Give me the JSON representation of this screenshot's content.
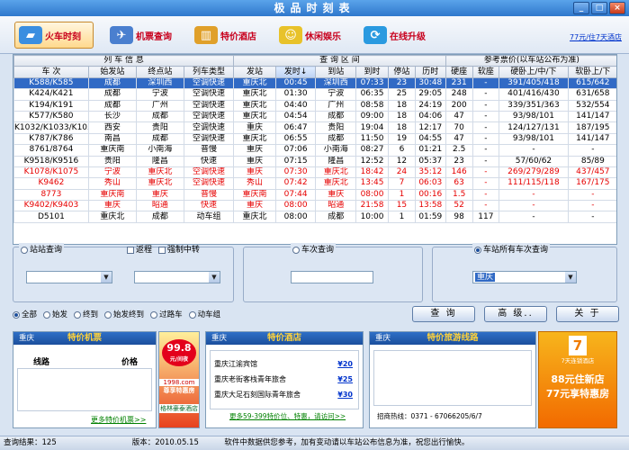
{
  "app": {
    "title": "极品时刻表",
    "ad_link": "77元/住7天酒店"
  },
  "toolbar": [
    {
      "label": "火车时刻",
      "icon": "train-icon",
      "color": "#3a8ee0"
    },
    {
      "label": "机票查询",
      "icon": "airplane-icon",
      "color": "#4a7fcf"
    },
    {
      "label": "特价酒店",
      "icon": "hotel-icon",
      "color": "#e0a02a"
    },
    {
      "label": "休闲娱乐",
      "icon": "smiley-icon",
      "color": "#e8c22a"
    },
    {
      "label": "在线升级",
      "icon": "upgrade-icon",
      "color": "#2a9ae0"
    }
  ],
  "grid": {
    "group_headers": {
      "train": "列 车 信 息",
      "query": "查 询 区 间",
      "price": "参考票价(以车站公布为准)"
    },
    "columns": [
      "车 次",
      "始发站",
      "终点站",
      "列车类型",
      "发站",
      "发时↓",
      "到站",
      "到时",
      "停站",
      "历时",
      "硬座",
      "软座",
      "硬卧上/中/下",
      "软卧上/下"
    ],
    "rows": [
      [
        "K588/K585",
        "成都",
        "深圳西",
        "空调快速",
        "重庆北",
        "00:45",
        "深圳西",
        "07:33",
        "23",
        "30:48",
        "231",
        "-",
        "391/405/418",
        "615/642"
      ],
      [
        "K424/K421",
        "成都",
        "宁波",
        "空调快速",
        "重庆北",
        "01:30",
        "宁波",
        "06:35",
        "25",
        "29:05",
        "248",
        "-",
        "401/416/430",
        "631/658"
      ],
      [
        "K194/K191",
        "成都",
        "广州",
        "空调快速",
        "重庆北",
        "04:40",
        "广州",
        "08:58",
        "18",
        "24:19",
        "200",
        "-",
        "339/351/363",
        "532/554"
      ],
      [
        "K577/K580",
        "长沙",
        "成都",
        "空调快速",
        "重庆北",
        "04:54",
        "成都",
        "09:00",
        "18",
        "04:06",
        "47",
        "-",
        "93/98/101",
        "141/147"
      ],
      [
        "K1032/K1033/K103",
        "西安",
        "贵阳",
        "空调快速",
        "重庆",
        "06:47",
        "贵阳",
        "19:04",
        "18",
        "12:17",
        "70",
        "-",
        "124/127/131",
        "187/195"
      ],
      [
        "K787/K786",
        "南昌",
        "成都",
        "空调快速",
        "重庆北",
        "06:55",
        "成都",
        "11:50",
        "19",
        "04:55",
        "47",
        "-",
        "93/98/101",
        "141/147"
      ],
      [
        "8761/8764",
        "重庆南",
        "小南海",
        "普慢",
        "重庆",
        "07:06",
        "小南海",
        "08:27",
        "6",
        "01:21",
        "2.5",
        "-",
        "-",
        "-"
      ],
      [
        "K9518/K9516",
        "贵阳",
        "隆昌",
        "快速",
        "重庆",
        "07:15",
        "隆昌",
        "12:52",
        "12",
        "05:37",
        "23",
        "-",
        "57/60/62",
        "85/89"
      ],
      [
        "K1078/K1075",
        "宁波",
        "重庆北",
        "空调快速",
        "重庆",
        "07:30",
        "重庆北",
        "18:42",
        "24",
        "35:12",
        "146",
        "-",
        "269/279/289",
        "437/457"
      ],
      [
        "K9462",
        "秀山",
        "重庆北",
        "空调快速",
        "秀山",
        "07:42",
        "重庆北",
        "13:45",
        "7",
        "06:03",
        "63",
        "-",
        "111/115/118",
        "167/175"
      ],
      [
        "8773",
        "重庆南",
        "重庆",
        "普慢",
        "重庆南",
        "07:44",
        "重庆",
        "08:00",
        "1",
        "00:16",
        "1.5",
        "-",
        "-",
        "-"
      ],
      [
        "K9402/K9403",
        "重庆",
        "昭通",
        "快速",
        "重庆",
        "08:00",
        "昭通",
        "21:58",
        "15",
        "13:58",
        "52",
        "-",
        "-",
        "-"
      ],
      [
        "D5101",
        "重庆北",
        "成都",
        "动车组",
        "重庆北",
        "08:00",
        "成都",
        "10:00",
        "1",
        "01:59",
        "98",
        "117",
        "-",
        "-"
      ]
    ]
  },
  "search": {
    "station_label": "站站查询",
    "return_label": "返程",
    "force_transfer_label": "强制中转",
    "train_label": "车次查询",
    "all_trains_label": "车站所有车次查询",
    "station_value": "重庆"
  },
  "filters": [
    "全部",
    "始发",
    "终到",
    "始发终到",
    "过路车",
    "动车组"
  ],
  "buttons": {
    "query": "查 询",
    "advanced": "高 级..",
    "close": "关 于"
  },
  "panels": {
    "tickets": {
      "city": "重庆",
      "title": "特价机票",
      "col_route": "线路",
      "col_price": "价格",
      "more": "更多特价机票>>"
    },
    "promo": {
      "price": "99.8",
      "unit": "元/间夜",
      "site": "1998.com",
      "line1": "尊享特惠房",
      "line2": "格林豪泰酒店"
    },
    "hotels": {
      "city": "重庆",
      "title": "特价酒店",
      "items": [
        {
          "name": "重庆江渝宾馆",
          "price": "¥20"
        },
        {
          "name": "重庆老街客栈青年旅舍",
          "price": "¥25"
        },
        {
          "name": "重庆大足石刻国际青年旅舍",
          "price": "¥30"
        }
      ],
      "more": "更多59-399特价位、特惠，请访问>>"
    },
    "tours": {
      "city": "重庆",
      "title": "特价旅游线路",
      "hotline": "招商热线：0371 - 67066205/6/7"
    },
    "ad7": {
      "logo": "7",
      "brand": "7天连锁酒店",
      "line1": "88元住新店",
      "line2": "77元享特惠房"
    }
  },
  "status": {
    "result": "查询结果：125",
    "version": "版本：2010.05.15",
    "notice": "软件中数据供您参考，加有变动请以车站公布信息为准，祝您出行愉快。"
  }
}
